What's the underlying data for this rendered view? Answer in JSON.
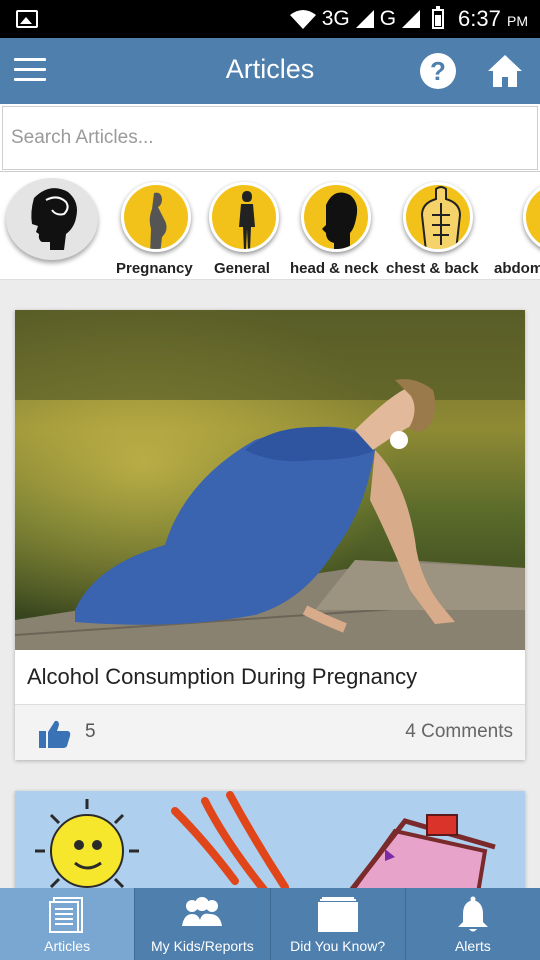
{
  "status_bar": {
    "network": "3G",
    "network2": "G",
    "time": "6:37",
    "ampm": "PM"
  },
  "app_bar": {
    "title": "Articles",
    "help_label": "?"
  },
  "search": {
    "placeholder": "Search Articles..."
  },
  "categories": [
    {
      "label": "Pregnancy"
    },
    {
      "label": "General"
    },
    {
      "label": "head & neck"
    },
    {
      "label": "chest & back"
    },
    {
      "label": "abdomen"
    }
  ],
  "articles": [
    {
      "title": "Alcohol Consumption During Pregnancy",
      "likes": "5",
      "comments": "4 Comments"
    }
  ],
  "bottom_nav": [
    {
      "label": "Articles",
      "icon": "articles-icon",
      "active": true
    },
    {
      "label": "My Kids/Reports",
      "icon": "kids-icon",
      "active": false
    },
    {
      "label": "Did You Know?",
      "icon": "book-icon",
      "active": false
    },
    {
      "label": "Alerts",
      "icon": "bell-icon",
      "active": false
    }
  ],
  "colors": {
    "primary": "#4f7fad",
    "active_tab": "#79a7d2",
    "category_yellow": "#f2c21a"
  }
}
